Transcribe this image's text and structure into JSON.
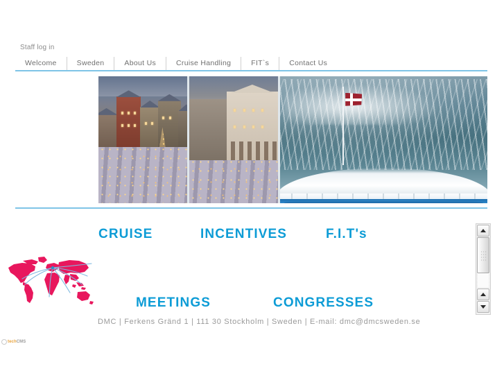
{
  "page": {
    "background_color": "#ffffff",
    "accent_blue": "#0d9cd6",
    "rule_blue": "#7ec4e6"
  },
  "staff": {
    "login_label": "Staff log in"
  },
  "nav": {
    "items": [
      {
        "label": "Welcome"
      },
      {
        "label": "Sweden"
      },
      {
        "label": "About Us"
      },
      {
        "label": "Cruise Handling"
      },
      {
        "label": "FIT`s"
      },
      {
        "label": "Contact Us"
      }
    ]
  },
  "banner": {
    "images": [
      {
        "alt": "Stockholm Gamla Stan Stortorget christmas market at dusk"
      },
      {
        "alt": "Stockholm Stortorget palace facade with christmas market stalls"
      },
      {
        "alt": "Ship stern with Danish flag over sea wake"
      }
    ]
  },
  "services": {
    "row1": [
      {
        "label": "CRUISE"
      },
      {
        "label": "INCENTIVES"
      },
      {
        "label": "F.I.T's"
      }
    ],
    "row2": [
      {
        "label": "MEETINGS"
      },
      {
        "label": "CONGRESSES"
      }
    ]
  },
  "worldmap": {
    "alt": "World map with travel routes radiating from Europe",
    "land_color": "#e8175d",
    "route_color": "#7fb9e0"
  },
  "contact": {
    "line": "DMC  |  Ferkens Gränd 1  |  111 30 Stockholm  |  Sweden  |  E-mail: dmc@dmcsweden.se"
  },
  "cms_badge": {
    "tech": "tech",
    "cms": "CMS"
  },
  "scrollbar": {
    "up_arrow": "scroll-up",
    "down_arrow": "scroll-down",
    "thumb": "scroll-thumb"
  }
}
